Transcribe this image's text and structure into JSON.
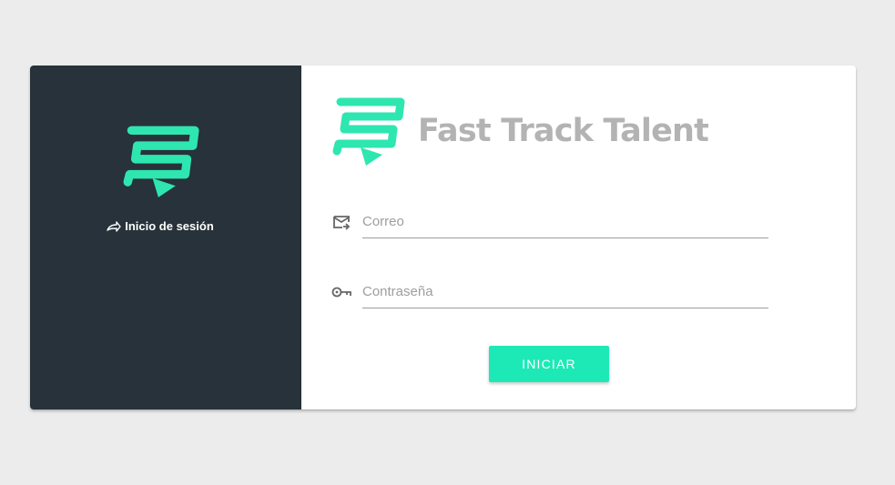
{
  "brand": {
    "name": "Fast Track Talent",
    "accent_color": "#1de9b6",
    "logo_icon": "fast-track-logo"
  },
  "sidebar": {
    "background": "#27323a",
    "login_label": "Inicio de sesión",
    "login_icon": "forward-arrow-icon"
  },
  "form": {
    "email": {
      "placeholder": "Correo",
      "value": "",
      "icon": "email-forward-icon"
    },
    "password": {
      "placeholder": "Contraseña",
      "value": "",
      "icon": "key-icon"
    },
    "submit_label": "INICIAR"
  }
}
